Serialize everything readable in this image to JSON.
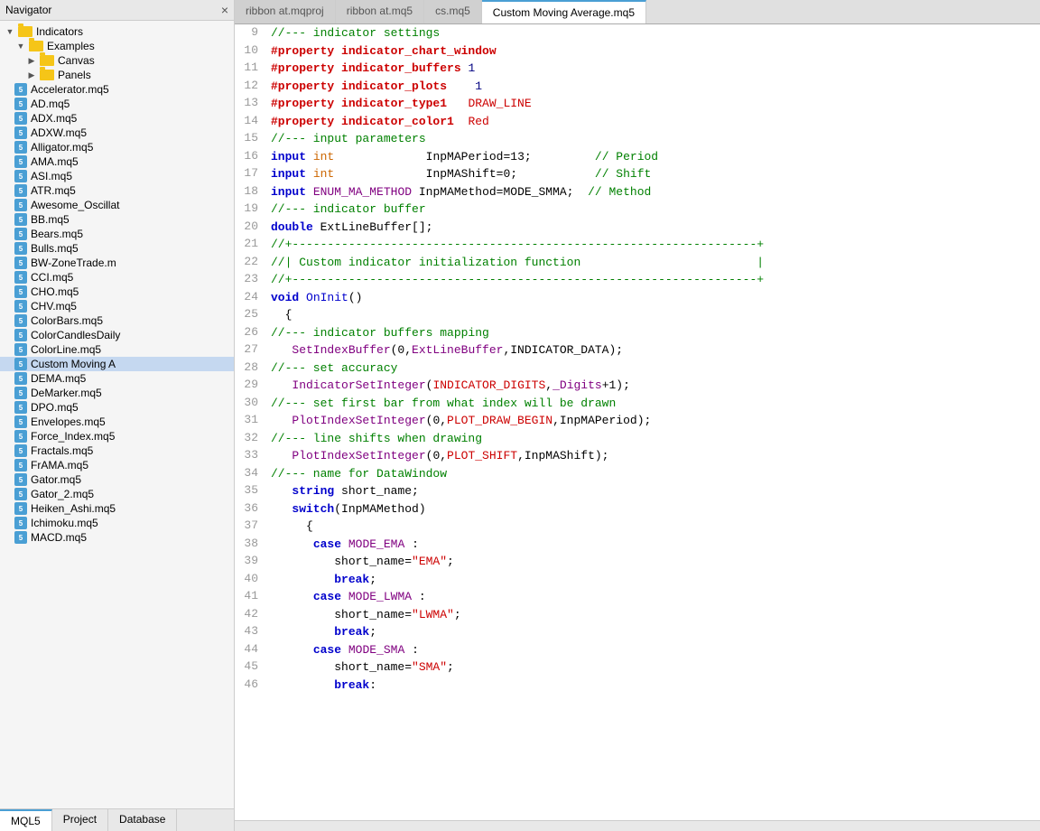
{
  "navigator": {
    "title": "Navigator",
    "close_label": "×",
    "root": {
      "label": "Indicators",
      "children": [
        {
          "label": "Examples",
          "type": "folder",
          "children": [
            {
              "label": "Canvas",
              "type": "folder"
            },
            {
              "label": "Panels",
              "type": "folder"
            }
          ]
        },
        {
          "label": "Accelerator.mq5",
          "type": "file"
        },
        {
          "label": "AD.mq5",
          "type": "file"
        },
        {
          "label": "ADX.mq5",
          "type": "file"
        },
        {
          "label": "ADXW.mq5",
          "type": "file"
        },
        {
          "label": "Alligator.mq5",
          "type": "file"
        },
        {
          "label": "AMA.mq5",
          "type": "file"
        },
        {
          "label": "ASI.mq5",
          "type": "file"
        },
        {
          "label": "ATR.mq5",
          "type": "file"
        },
        {
          "label": "Awesome_Oscillat",
          "type": "file"
        },
        {
          "label": "BB.mq5",
          "type": "file"
        },
        {
          "label": "Bears.mq5",
          "type": "file"
        },
        {
          "label": "Bulls.mq5",
          "type": "file"
        },
        {
          "label": "BW-ZoneTrade.m",
          "type": "file"
        },
        {
          "label": "CCI.mq5",
          "type": "file"
        },
        {
          "label": "CHO.mq5",
          "type": "file"
        },
        {
          "label": "CHV.mq5",
          "type": "file"
        },
        {
          "label": "ColorBars.mq5",
          "type": "file"
        },
        {
          "label": "ColorCandlesDaily",
          "type": "file"
        },
        {
          "label": "ColorLine.mq5",
          "type": "file"
        },
        {
          "label": "Custom Moving A",
          "type": "file",
          "active": true
        },
        {
          "label": "DEMA.mq5",
          "type": "file"
        },
        {
          "label": "DeMarker.mq5",
          "type": "file"
        },
        {
          "label": "DPO.mq5",
          "type": "file"
        },
        {
          "label": "Envelopes.mq5",
          "type": "file"
        },
        {
          "label": "Force_Index.mq5",
          "type": "file"
        },
        {
          "label": "Fractals.mq5",
          "type": "file"
        },
        {
          "label": "FrAMA.mq5",
          "type": "file"
        },
        {
          "label": "Gator.mq5",
          "type": "file"
        },
        {
          "label": "Gator_2.mq5",
          "type": "file"
        },
        {
          "label": "Heiken_Ashi.mq5",
          "type": "file"
        },
        {
          "label": "Ichimoku.mq5",
          "type": "file"
        },
        {
          "label": "MACD.mq5",
          "type": "file"
        }
      ]
    },
    "tabs": [
      {
        "label": "MQL5",
        "active": true
      },
      {
        "label": "Project",
        "active": false
      },
      {
        "label": "Database",
        "active": false
      }
    ]
  },
  "editor": {
    "tabs": [
      {
        "label": "ribbon at.mqproj",
        "active": false
      },
      {
        "label": "ribbon at.mq5",
        "active": false
      },
      {
        "label": "cs.mq5",
        "active": false
      },
      {
        "label": "Custom Moving Average.mq5",
        "active": true
      }
    ]
  }
}
